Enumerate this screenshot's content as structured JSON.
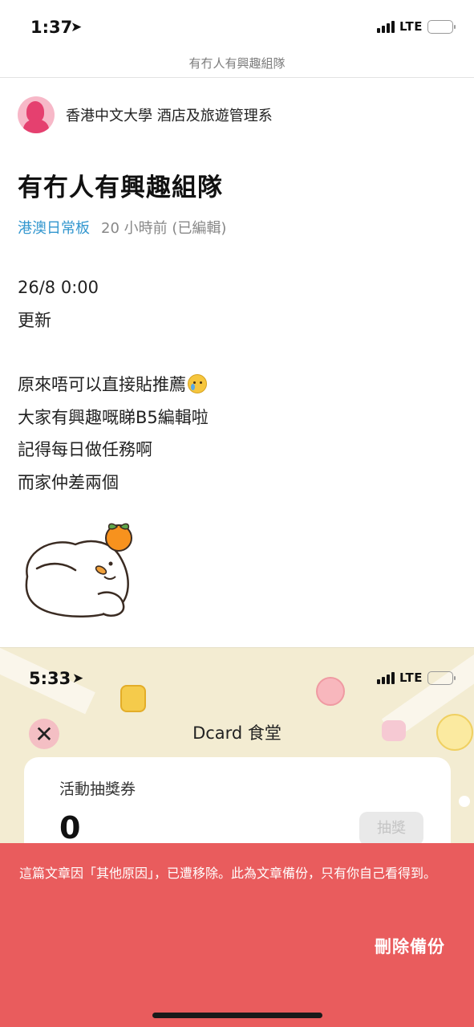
{
  "status_bar": {
    "time": "1:37",
    "network": "LTE",
    "location_glyph": "➤"
  },
  "header": {
    "title": "有冇人有興趣組隊"
  },
  "post": {
    "author": "香港中文大學 酒店及旅遊管理系",
    "title": "有冇人有興趣組隊",
    "forum": "港澳日常板",
    "time": "20 小時前 (已編輯)",
    "lines": {
      "l1": "26/8 0:00",
      "l2": "更新",
      "l3": "原來唔可以直接貼推薦",
      "l4": "大家有興趣嘅睇B5編輯啦",
      "l5": "記得每日做任務啊",
      "l6": "而家仲差兩個"
    },
    "emoji_icon": "crying-smile-emoji"
  },
  "embedded_screenshot": {
    "time": "5:33",
    "network": "LTE",
    "title": "Dcard 食堂",
    "close_glyph": "✕",
    "card_label": "活動抽獎券",
    "count": "0",
    "draw_button": "抽獎"
  },
  "banner": {
    "message": "這篇文章因「其他原因」，已遭移除。此為文章備份，只有你自己看得到。",
    "delete_label": "刪除備份"
  },
  "colors": {
    "accent_blue": "#3397cf",
    "banner_red": "#e95c5d",
    "battery_yellow": "#f5c518"
  }
}
